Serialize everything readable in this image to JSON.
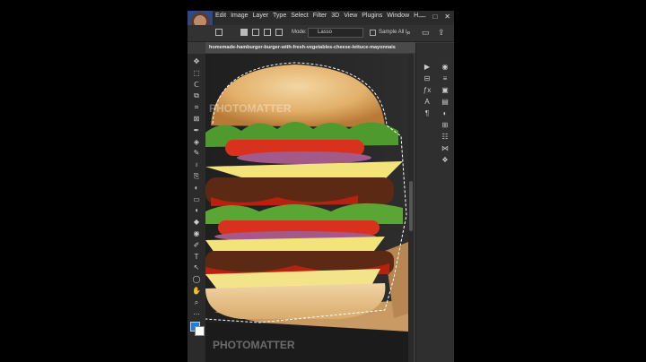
{
  "menu": {
    "items": [
      "Edit",
      "Image",
      "Layer",
      "Type",
      "Select",
      "Filter",
      "3D",
      "View",
      "Plugins",
      "Window",
      "H"
    ],
    "window_controls": [
      "—",
      "□",
      "✕"
    ]
  },
  "options": {
    "mode_label": "Mode:",
    "mode_value": "Lasso",
    "sample_label": "Sample All L",
    "right_icons": [
      "⌕",
      "▭",
      "⇪"
    ]
  },
  "document": {
    "tab_title": "homemade-hamburger-burger-with-fresh-vegetables-cheese-lettuce-mayonnais"
  },
  "watermark": {
    "text1": "PHOTOMATTER",
    "text2": "PHOTOMATTER"
  },
  "tools": [
    "✥",
    "⬚",
    "ᑕ",
    "⧉",
    "⌗",
    "⊠",
    "✒",
    "◈",
    "✎",
    "♁",
    "⎘",
    "◐",
    "▭",
    "◖",
    "◆",
    "◉",
    "✐",
    "T",
    "↖",
    "◯",
    "✋",
    "⌕",
    "⋯"
  ],
  "panels": {
    "col1": [
      "▶",
      "⊟",
      "ƒx",
      "A",
      "¶"
    ],
    "col2": [
      "◉",
      "≡",
      "▣",
      "▤",
      "◐",
      "⊞",
      "☷",
      "⋈",
      "❖"
    ]
  },
  "colors": {
    "foreground": "#1e7fd8",
    "background": "#ffffff"
  }
}
